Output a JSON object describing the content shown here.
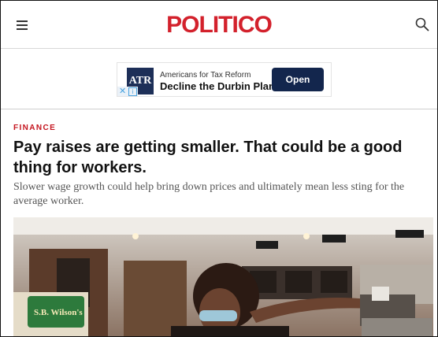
{
  "header": {
    "logo": "POLITICO",
    "menu_icon": "hamburger-menu-icon",
    "search_icon": "search-icon"
  },
  "ad": {
    "logo_text": "ATR",
    "sponsor": "Americans for Tax Reform",
    "headline": "Decline the Durbin Plan",
    "cta": "Open",
    "brand_color": "#13264d"
  },
  "article": {
    "kicker": "FINANCE",
    "headline": "Pay raises are getting smaller. That could be a good thing for workers.",
    "dek": "Slower wage growth could help bring down prices and ultimately mean less sting for the average worker.",
    "photo_sign": "S.B. Wilson's"
  },
  "colors": {
    "brand_red": "#d3212c",
    "kicker_red": "#c4141e"
  }
}
